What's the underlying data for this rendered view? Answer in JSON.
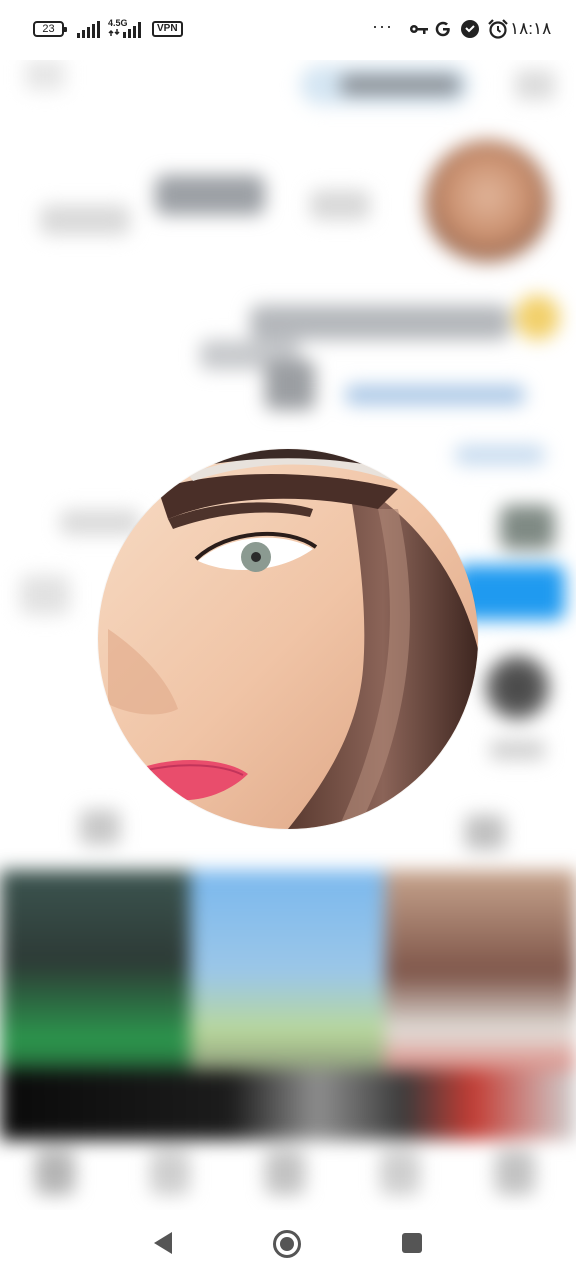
{
  "status_bar": {
    "battery": "23",
    "network_type": "4.5G",
    "vpn": "VPN",
    "more": "···",
    "icons": [
      "key-icon",
      "google-icon",
      "shield-icon",
      "alarm-icon"
    ],
    "time": "۱۸:۱۸"
  },
  "profile_popup": {
    "image": "profile-photo"
  },
  "nav_bar": {
    "buttons": [
      "back-icon",
      "home-icon",
      "recents-icon"
    ]
  }
}
